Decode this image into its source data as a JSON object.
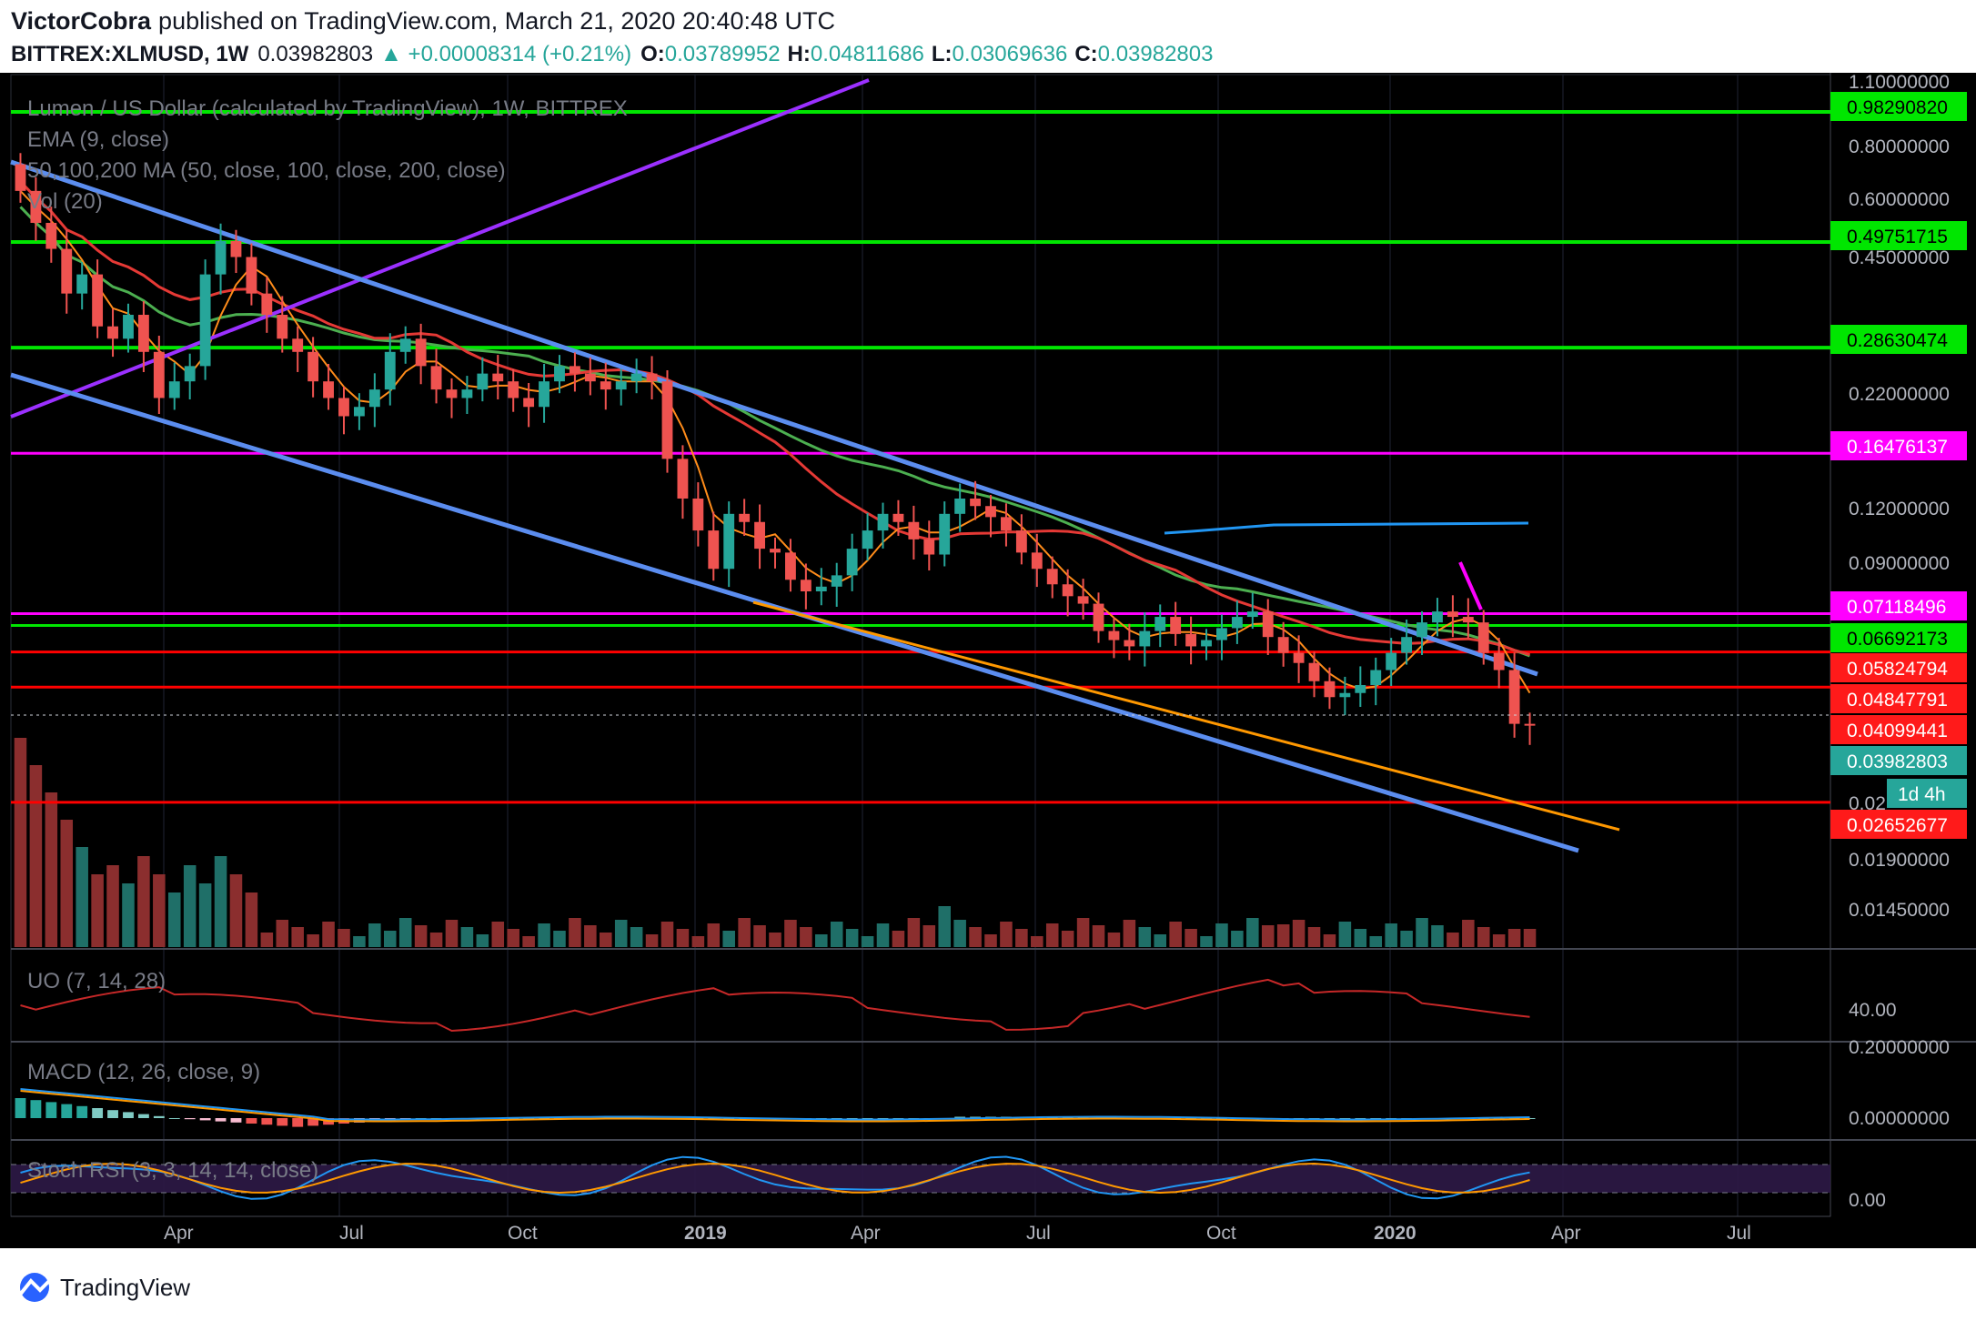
{
  "header": {
    "author": "VictorCobra",
    "published_text": "published on TradingView.com, March 21, 2020 20:40:48 UTC",
    "symbol": "BITTREX:XLMUSD, 1W",
    "last": "0.03982803",
    "change": "▲ +0.00008314 (+0.21%)",
    "open_label": "O:",
    "open": "0.03789952",
    "high_label": "H:",
    "high": "0.04811686",
    "low_label": "L:",
    "low": "0.03069636",
    "close_label": "C:",
    "close": "0.03982803"
  },
  "legend": {
    "main": "Lumen / US Dollar (calculated by TradingView), 1W, BITTREX",
    "ema": "EMA (9, close)",
    "ma": "50,100,200 MA (50, close, 100, close, 200, close)",
    "vol": "Vol (20)",
    "uo": "UO (7, 14, 28)",
    "macd": "MACD (12, 26, close, 9)",
    "stoch": "Stoch RSI (3, 3, 14, 14, close)"
  },
  "colors": {
    "background": "#000000",
    "up": "#26a69a",
    "down": "#ef5350",
    "green_level": "#00e600",
    "magenta_level": "#ff00ff",
    "red_level": "#ff0000",
    "channel": "#5b8def",
    "purple_trend": "#9b30ff",
    "orange_trend": "#ff9800",
    "ema": "#ff8c1a",
    "ma50": "#e53935",
    "ma100": "#4caf50",
    "ma200": "#2196f3"
  },
  "price_axis": {
    "ticks": [
      "1.10000000",
      "0.80000000",
      "0.60000000",
      "0.45000000",
      "0.22000000",
      "0.12000000",
      "0.09000000",
      "0.02",
      "0.01900000",
      "0.01450000"
    ],
    "tags": [
      {
        "text": "0.98290820",
        "kind": "green"
      },
      {
        "text": "0.49751715",
        "kind": "green"
      },
      {
        "text": "0.28630474",
        "kind": "green"
      },
      {
        "text": "0.16476137",
        "kind": "magenta"
      },
      {
        "text": "0.07118496",
        "kind": "magenta"
      },
      {
        "text": "0.06692173",
        "kind": "green"
      },
      {
        "text": "0.05824794",
        "kind": "red"
      },
      {
        "text": "0.04847791",
        "kind": "red"
      },
      {
        "text": "0.04099441",
        "kind": "red"
      },
      {
        "text": "0.03982803",
        "kind": "teal"
      },
      {
        "text": "1d 4h",
        "kind": "teal"
      },
      {
        "text": "0.02652677",
        "kind": "red"
      }
    ]
  },
  "uo_axis": {
    "ticks": [
      "40.00"
    ]
  },
  "macd_axis": {
    "ticks": [
      "0.20000000",
      "0.00000000"
    ]
  },
  "stoch_axis": {
    "ticks": [
      "0.00"
    ]
  },
  "time_axis": {
    "labels": [
      "Apr",
      "Jul",
      "Oct",
      "2019",
      "Apr",
      "Jul",
      "Oct",
      "2020",
      "Apr",
      "Jul"
    ]
  },
  "footer": {
    "brand": "TradingView"
  },
  "chart_data": {
    "type": "candlestick",
    "title": "Lumen / US Dollar (calculated by TradingView), 1W, BITTREX",
    "y_scale": "log",
    "ylim": [
      0.0125,
      1.15
    ],
    "x_range": [
      "2018-01",
      "2020-08"
    ],
    "closes_approx": [
      0.65,
      0.55,
      0.48,
      0.38,
      0.42,
      0.32,
      0.3,
      0.34,
      0.28,
      0.22,
      0.24,
      0.26,
      0.42,
      0.5,
      0.46,
      0.38,
      0.34,
      0.3,
      0.28,
      0.24,
      0.22,
      0.2,
      0.21,
      0.23,
      0.28,
      0.3,
      0.26,
      0.23,
      0.22,
      0.23,
      0.25,
      0.24,
      0.22,
      0.21,
      0.24,
      0.26,
      0.25,
      0.24,
      0.23,
      0.24,
      0.25,
      0.24,
      0.16,
      0.13,
      0.11,
      0.09,
      0.12,
      0.115,
      0.1,
      0.098,
      0.085,
      0.08,
      0.082,
      0.087,
      0.1,
      0.11,
      0.12,
      0.115,
      0.105,
      0.097,
      0.12,
      0.13,
      0.125,
      0.118,
      0.11,
      0.098,
      0.09,
      0.083,
      0.078,
      0.075,
      0.065,
      0.062,
      0.06,
      0.065,
      0.07,
      0.064,
      0.06,
      0.062,
      0.066,
      0.07,
      0.072,
      0.063,
      0.058,
      0.055,
      0.05,
      0.046,
      0.047,
      0.049,
      0.053,
      0.058,
      0.063,
      0.068,
      0.072,
      0.07,
      0.068,
      0.058,
      0.053,
      0.04,
      0.0398
    ],
    "levels": [
      {
        "value": 0.9829082,
        "label": "0.98290820",
        "color": "green"
      },
      {
        "value": 0.49751715,
        "label": "0.49751715",
        "color": "green"
      },
      {
        "value": 0.28630474,
        "label": "0.28630474",
        "color": "green"
      },
      {
        "value": 0.16476137,
        "label": "0.16476137",
        "color": "magenta"
      },
      {
        "value": 0.07118496,
        "label": "0.07118496",
        "color": "magenta"
      },
      {
        "value": 0.06692173,
        "label": "0.06692173",
        "color": "green"
      },
      {
        "value": 0.05824794,
        "label": "0.05824794",
        "color": "red"
      },
      {
        "value": 0.04847791,
        "label": "0.04847791",
        "color": "red"
      },
      {
        "value": 0.02652677,
        "label": "0.02652677",
        "color": "red"
      }
    ],
    "last_close": 0.03982803
  }
}
